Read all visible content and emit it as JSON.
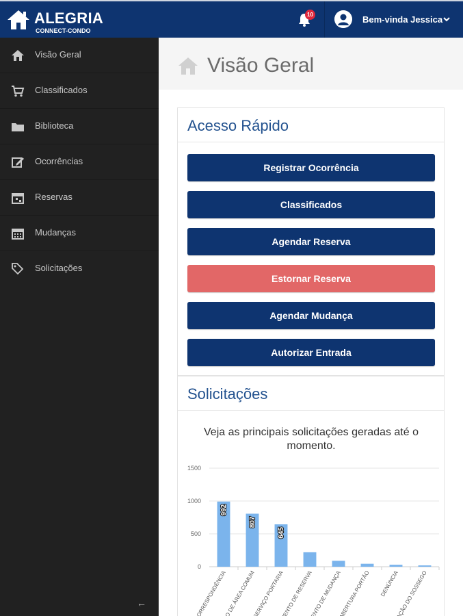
{
  "brand": {
    "title": "ALEGRIA",
    "subtitle": "CONNECT-CONDO"
  },
  "header": {
    "notifications": {
      "count": "10",
      "icon": "bell-icon"
    },
    "user": {
      "greeting": "Bem-vinda Jessica",
      "icon": "user-circle-icon",
      "menu_icon": "chevron-down-icon"
    }
  },
  "colors": {
    "primary": "#0e3470",
    "danger": "#e26767",
    "sidebar": "#212121",
    "bar": "#7bb4ec"
  },
  "sidebar": {
    "items": [
      {
        "label": "Visão Geral",
        "icon": "home-icon"
      },
      {
        "label": "Classificados",
        "icon": "cart-icon"
      },
      {
        "label": "Biblioteca",
        "icon": "folder-icon"
      },
      {
        "label": "Ocorrências",
        "icon": "edit-icon"
      },
      {
        "label": "Reservas",
        "icon": "calendar-icon"
      },
      {
        "label": "Mudanças",
        "icon": "calendar-icon"
      },
      {
        "label": "Solicitações",
        "icon": "tags-icon"
      }
    ],
    "collapse_label": "←"
  },
  "page": {
    "title": "Visão Geral",
    "icon": "home-icon"
  },
  "quick_access": {
    "title": "Acesso Rápido",
    "buttons": [
      {
        "label": "Registrar Ocorrência",
        "style": "primary"
      },
      {
        "label": "Classificados",
        "style": "primary"
      },
      {
        "label": "Agendar Reserva",
        "style": "primary"
      },
      {
        "label": "Estornar Reserva",
        "style": "danger"
      },
      {
        "label": "Agendar Mudança",
        "style": "primary"
      },
      {
        "label": "Autorizar Entrada",
        "style": "primary"
      }
    ]
  },
  "requests": {
    "title": "Solicitações",
    "intro": "Veja as principais solicitações geradas até o momento."
  },
  "chart_data": {
    "type": "bar",
    "categories": [
      "CORRESPONDÊNCIA",
      "USO DE ÁREA COMUM",
      "SERVIÇO PORTARIA",
      "CANCELAMENTO DE RESERVA",
      "AGENDAMENTO DE MUDANÇA",
      "ABERTURA PORTÃO",
      "DENÚNCIA",
      "PERTURBAÇÃO DO SOSSEGO"
    ],
    "values": [
      992,
      807,
      645,
      220,
      90,
      45,
      30,
      20
    ],
    "value_labels": [
      "992",
      "807",
      "645",
      "",
      "",
      "",
      "",
      ""
    ],
    "ylim": [
      0,
      1500
    ],
    "yticks": [
      0,
      500,
      1000,
      1500
    ],
    "grid": true,
    "title": "",
    "xlabel": "",
    "ylabel": ""
  }
}
